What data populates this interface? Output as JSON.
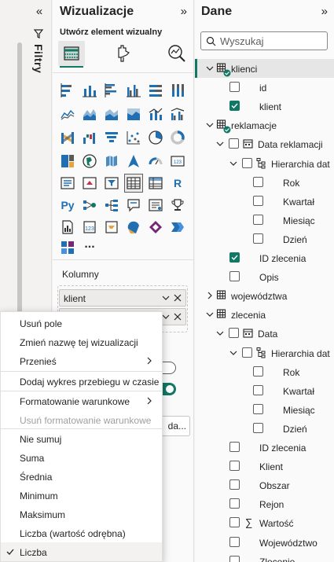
{
  "filters": {
    "label": "Filtry"
  },
  "viz": {
    "title": "Wizualizacje",
    "subtitle": "Utwórz element wizualny",
    "field_wells_label": "Kolumny",
    "fields": [
      {
        "label": "klient"
      },
      {
        "label": ""
      }
    ],
    "partial_button": "da...",
    "gallery_text": [
      "R",
      "Py",
      "..."
    ]
  },
  "menu": {
    "items": [
      {
        "label": "Usuń pole"
      },
      {
        "label": "Zmień nazwę tej wizualizacji"
      },
      {
        "label": "Przenieś"
      },
      {
        "label": "Dodaj wykres przebiegu w czasie"
      },
      {
        "label": "Formatowanie warunkowe"
      },
      {
        "label": "Usuń formatowanie warunkowe"
      },
      {
        "label": "Nie sumuj"
      },
      {
        "label": "Suma"
      },
      {
        "label": "Średnia"
      },
      {
        "label": "Minimum"
      },
      {
        "label": "Maksimum"
      },
      {
        "label": "Liczba (wartość odrębna)"
      },
      {
        "label": "Liczba"
      }
    ]
  },
  "data": {
    "title": "Dane",
    "search_placeholder": "Wyszukaj",
    "tree": [
      {
        "label": "klienci"
      },
      {
        "label": "id"
      },
      {
        "label": "klient"
      },
      {
        "label": "reklamacje"
      },
      {
        "label": "Data reklamacji"
      },
      {
        "label": "Hierarchia dat"
      },
      {
        "label": "Rok"
      },
      {
        "label": "Kwartał"
      },
      {
        "label": "Miesiąc"
      },
      {
        "label": "Dzień"
      },
      {
        "label": "ID zlecenia"
      },
      {
        "label": "Opis"
      },
      {
        "label": "województwa"
      },
      {
        "label": "zlecenia"
      },
      {
        "label": "Data"
      },
      {
        "label": "Hierarchia dat"
      },
      {
        "label": "Rok"
      },
      {
        "label": "Kwartał"
      },
      {
        "label": "Miesiąc"
      },
      {
        "label": "Dzień"
      },
      {
        "label": "ID zlecenia"
      },
      {
        "label": "Klient"
      },
      {
        "label": "Obszar"
      },
      {
        "label": "Rejon"
      },
      {
        "label": "Wartość"
      },
      {
        "label": "Województwo"
      },
      {
        "label": "Zlecenie"
      }
    ]
  },
  "colors": {
    "accent": "#117865",
    "selected_bg": "#e6e6e6"
  }
}
